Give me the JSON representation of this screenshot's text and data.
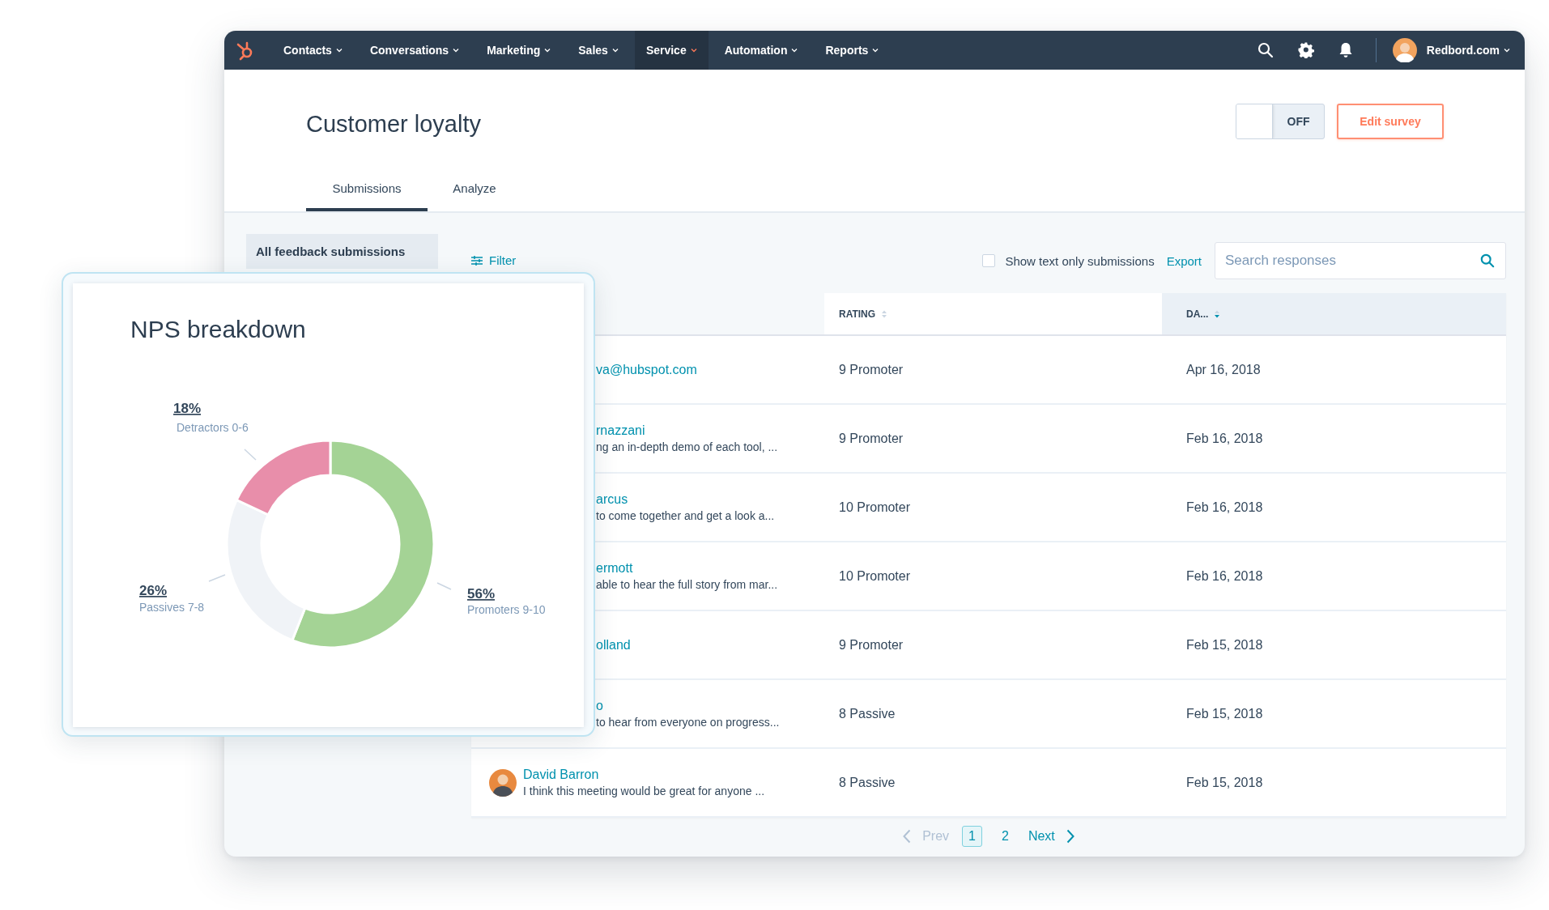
{
  "nav": {
    "items": [
      {
        "label": "Contacts",
        "selected": false
      },
      {
        "label": "Conversations",
        "selected": false
      },
      {
        "label": "Marketing",
        "selected": false
      },
      {
        "label": "Sales",
        "selected": false
      },
      {
        "label": "Service",
        "selected": true
      },
      {
        "label": "Automation",
        "selected": false
      },
      {
        "label": "Reports",
        "selected": false
      }
    ],
    "account": "Redbord.com"
  },
  "header": {
    "title": "Customer loyalty",
    "toggle": {
      "label": "OFF",
      "on": false
    },
    "edit_button": "Edit survey"
  },
  "tabs": [
    {
      "label": "Submissions",
      "selected": true
    },
    {
      "label": "Analyze",
      "selected": false
    }
  ],
  "sidebar": {
    "items": [
      {
        "label": "All feedback submissions",
        "selected": true
      }
    ]
  },
  "toolbar": {
    "filter": "Filter",
    "checkbox": {
      "label": "Show text only submissions",
      "checked": false
    },
    "export": "Export",
    "search": {
      "placeholder": "Search responses"
    }
  },
  "table": {
    "columns": [
      {
        "label": "RATING",
        "sorted": false
      },
      {
        "label": "DA...",
        "sorted": true
      }
    ],
    "rows": [
      {
        "name": "va@hubspot.com",
        "rating": "9 Promoter",
        "date": "Apr 16, 2018"
      },
      {
        "name": "rnazzani",
        "snippet": "ng an in-depth demo of each tool, ...",
        "rating": "9 Promoter",
        "date": "Feb 16, 2018"
      },
      {
        "name": "arcus",
        "snippet": "to come together and get a look a...",
        "rating": "10 Promoter",
        "date": "Feb 16, 2018"
      },
      {
        "name": "ermott",
        "snippet": "able to hear the full story from mar...",
        "rating": "10 Promoter",
        "date": "Feb 16, 2018"
      },
      {
        "name": "olland",
        "rating": "9 Promoter",
        "date": "Feb 15, 2018"
      },
      {
        "name": "o",
        "snippet": "to hear from everyone on progress...",
        "rating": "8 Passive",
        "date": "Feb 15, 2018"
      },
      {
        "name": "David Barron",
        "snippet": "I think this meeting would be great for anyone ...",
        "rating": "8 Passive",
        "date": "Feb 15, 2018",
        "avatar": true
      }
    ]
  },
  "pagination": {
    "prev": {
      "label": "Prev",
      "disabled": true
    },
    "pages": [
      {
        "label": "1",
        "selected": true
      },
      {
        "label": "2",
        "selected": false
      }
    ],
    "next": {
      "label": "Next",
      "disabled": false
    }
  },
  "nps_card": {
    "chart_data": {
      "type": "donut",
      "title": "NPS breakdown",
      "categories": [
        "Detractors 0-6",
        "Passives 7-8",
        "Promoters 9-10"
      ],
      "values": [
        18,
        26,
        56
      ],
      "colors": [
        "#e88eaa",
        "#f0f3f7",
        "#a4d395"
      ],
      "value_labels": [
        "18%",
        "26%",
        "56%"
      ]
    }
  }
}
